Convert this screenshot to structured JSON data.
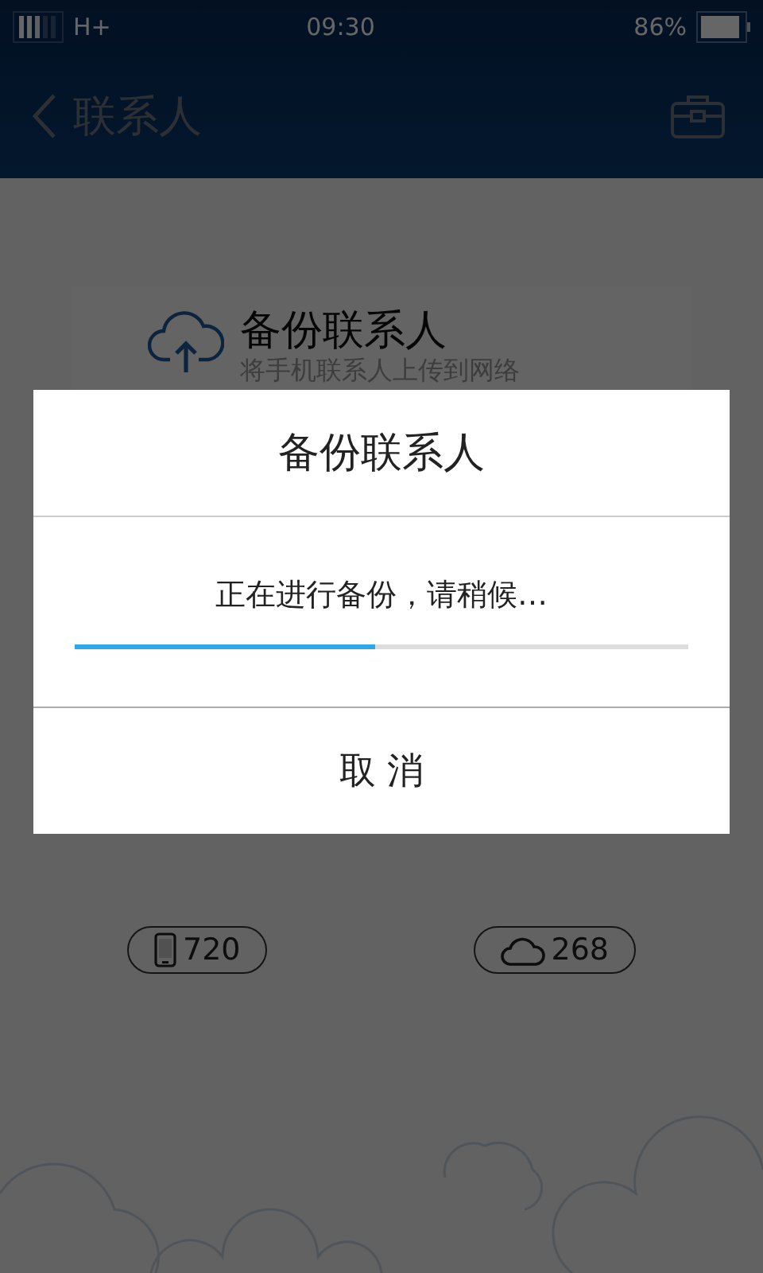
{
  "status_bar": {
    "network": "H+",
    "time": "09:30",
    "battery": "86%"
  },
  "header": {
    "title": "联系人"
  },
  "backup_card": {
    "title": "备份联系人",
    "subtitle": "将手机联系人上传到网络"
  },
  "counts": [
    {
      "kind": "phone",
      "value": "720"
    },
    {
      "kind": "cloud",
      "value": "268"
    }
  ],
  "dialog": {
    "title": "备份联系人",
    "message": "正在进行备份，请稍候…",
    "progress": {
      "level": 0.49
    },
    "cancel": "取 消"
  }
}
